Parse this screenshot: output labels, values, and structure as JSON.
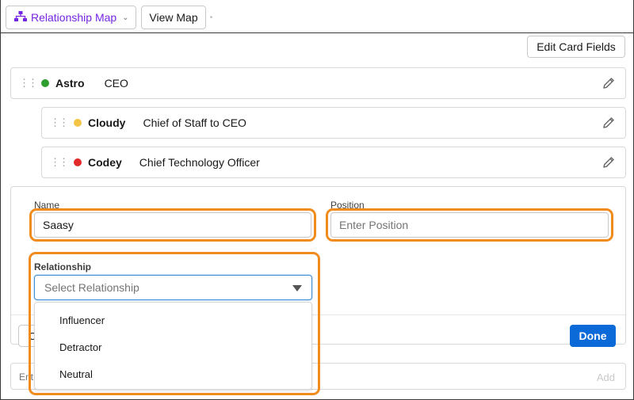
{
  "toolbar": {
    "map_menu_label": "Relationship Map",
    "view_map_label": "View Map",
    "edit_card_fields_label": "Edit Card Fields"
  },
  "cards": [
    {
      "name": "Astro",
      "title": "CEO",
      "status_color": "#2e9e2e"
    },
    {
      "name": "Cloudy",
      "title": "Chief of Staff to CEO",
      "status_color": "#f5c445"
    },
    {
      "name": "Codey",
      "title": "Chief Technology Officer",
      "status_color": "#e22a2a"
    }
  ],
  "form": {
    "name_label": "Name",
    "name_value": "Saasy",
    "position_label": "Position",
    "position_placeholder": "Enter Position",
    "relationship_label": "Relationship",
    "relationship_placeholder": "Select Relationship",
    "relationship_options": [
      "Influencer",
      "Detractor",
      "Neutral"
    ],
    "cancel_stub": "Ca",
    "done_label": "Done"
  },
  "add_row": {
    "placeholder": "Ent",
    "add_label": "Add"
  },
  "colors": {
    "accent": "#7526e3",
    "highlight": "#f08c1e",
    "brand_blue": "#0b69d8"
  },
  "icons": {
    "map": "hierarchy-icon",
    "chevron": "chevron-down-icon",
    "edit": "pencil-icon",
    "drag": "drag-handle-icon",
    "select_caret": "caret-down-icon"
  }
}
